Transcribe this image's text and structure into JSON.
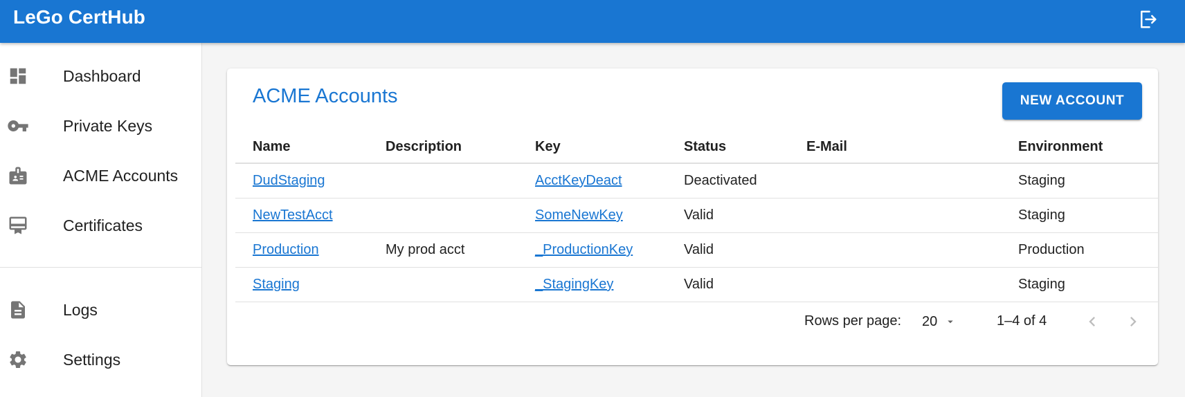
{
  "app": {
    "title": "LeGo CertHub"
  },
  "header": {
    "logout_icon": "logout-icon"
  },
  "sidebar": {
    "items": [
      {
        "label": "Dashboard",
        "icon": "dashboard-icon"
      },
      {
        "label": "Private Keys",
        "icon": "key-icon"
      },
      {
        "label": "ACME Accounts",
        "icon": "account-box-icon"
      },
      {
        "label": "Certificates",
        "icon": "certificate-icon"
      },
      {
        "label": "Logs",
        "icon": "document-icon"
      },
      {
        "label": "Settings",
        "icon": "gear-icon"
      }
    ]
  },
  "main": {
    "title": "ACME Accounts",
    "new_button": "NEW ACCOUNT",
    "table": {
      "columns": [
        "Name",
        "Description",
        "Key",
        "Status",
        "E-Mail",
        "Environment"
      ],
      "rows": [
        {
          "name": "DudStaging",
          "description": "",
          "key": "AcctKeyDeact",
          "status": "Deactivated",
          "email": "",
          "environment": "Staging"
        },
        {
          "name": "NewTestAcct",
          "description": "",
          "key": "SomeNewKey",
          "status": "Valid",
          "email": "",
          "environment": "Staging"
        },
        {
          "name": "Production",
          "description": "My prod acct",
          "key": "_ProductionKey",
          "status": "Valid",
          "email": "",
          "environment": "Production"
        },
        {
          "name": "Staging",
          "description": "",
          "key": "_StagingKey",
          "status": "Valid",
          "email": "",
          "environment": "Staging"
        }
      ]
    },
    "pagination": {
      "rows_per_page_label": "Rows per page:",
      "rows_per_page": "20",
      "range": "1–4 of 4"
    }
  },
  "colors": {
    "primary": "#1976d2",
    "background": "#f5f5f5"
  }
}
